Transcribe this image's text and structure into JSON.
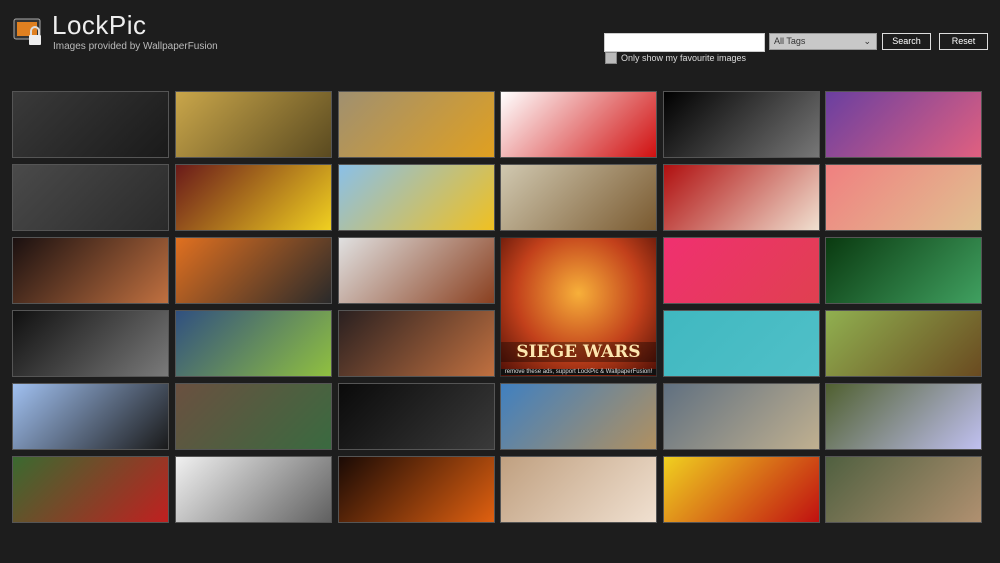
{
  "app": {
    "title": "LockPic",
    "subtitle": "Images provided by WallpaperFusion"
  },
  "toolbar": {
    "search_value": "",
    "tags_selected": "All Tags",
    "search_label": "Search",
    "reset_label": "Reset",
    "favourites_label": "Only show my favourite images",
    "favourites_checked": false
  },
  "ad": {
    "title": "SIEGE WARS",
    "caption": "remove these ads, support LockPic & WallpaperFusion!"
  },
  "tiles": [
    [
      "#3a3a3a",
      "#1a1a1a"
    ],
    [
      "#c9a64a",
      "#5a4a20"
    ],
    [
      "#a09070",
      "#e0a020"
    ],
    [
      "#ffffff",
      "#d01010"
    ],
    [
      "#000000",
      "#777777"
    ],
    [
      "#6a3fa0",
      "#e06080"
    ],
    [
      "#4a4a4a",
      "#2a2a2a"
    ],
    [
      "#6a1a1a",
      "#f0d020"
    ],
    [
      "#8ac0e8",
      "#f0c020"
    ],
    [
      "#d0c8b0",
      "#7a5a30"
    ],
    [
      "#b01010",
      "#f0e0d0"
    ],
    [
      "#f08080",
      "#e0c090"
    ],
    [
      "#1a1010",
      "#c07040"
    ],
    [
      "#e07020",
      "#2a2a2a"
    ],
    [
      "#e0e0e0",
      "#8a4020"
    ],
    null,
    [
      "#f03070",
      "#e04050"
    ],
    [
      "#0a3a10",
      "#40a060"
    ],
    [
      "#101010",
      "#7a7a7a"
    ],
    [
      "#305080",
      "#90c040"
    ],
    [
      "#2a2020",
      "#c07040"
    ],
    null,
    [
      "#40b8c0",
      "#50c0c8"
    ],
    [
      "#90b050",
      "#6a4a20"
    ],
    [
      "#a0c0f0",
      "#1a1a1a"
    ],
    [
      "#6a5040",
      "#3a6a40"
    ],
    [
      "#0a0a0a",
      "#3a3a3a"
    ],
    [
      "#4080c0",
      "#b09060"
    ],
    [
      "#607080",
      "#c0b090"
    ],
    [
      "#506030",
      "#c0c0f0"
    ],
    [
      "#3a6a30",
      "#c02020"
    ],
    [
      "#f0f0f0",
      "#606060"
    ],
    [
      "#1a0a05",
      "#e06010"
    ],
    [
      "#c0a080",
      "#f0e0d0"
    ],
    [
      "#f0d020",
      "#c01010"
    ],
    [
      "#506040",
      "#b09070"
    ]
  ]
}
